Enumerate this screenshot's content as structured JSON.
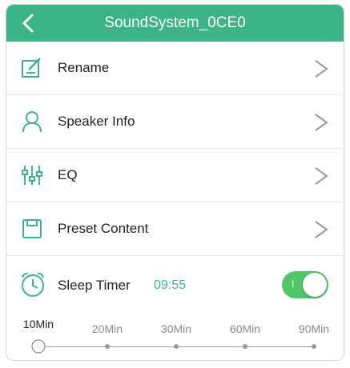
{
  "header": {
    "title": "SoundSystem_0CE0",
    "back_icon": "back-chevron-icon",
    "color": "#3db488"
  },
  "menu": [
    {
      "label": "Rename",
      "icon": "edit-icon"
    },
    {
      "label": "Speaker Info",
      "icon": "person-icon"
    },
    {
      "label": "EQ",
      "icon": "equalizer-icon"
    },
    {
      "label": "Preset Content",
      "icon": "save-icon"
    }
  ],
  "sleep_timer": {
    "label": "Sleep Timer",
    "time": "09:55",
    "toggle_on": true,
    "toggle_mark": "I",
    "toggle_color": "#52c46a",
    "options": [
      "10Min",
      "20Min",
      "30Min",
      "60Min",
      "90Min"
    ],
    "selected": "10Min"
  }
}
